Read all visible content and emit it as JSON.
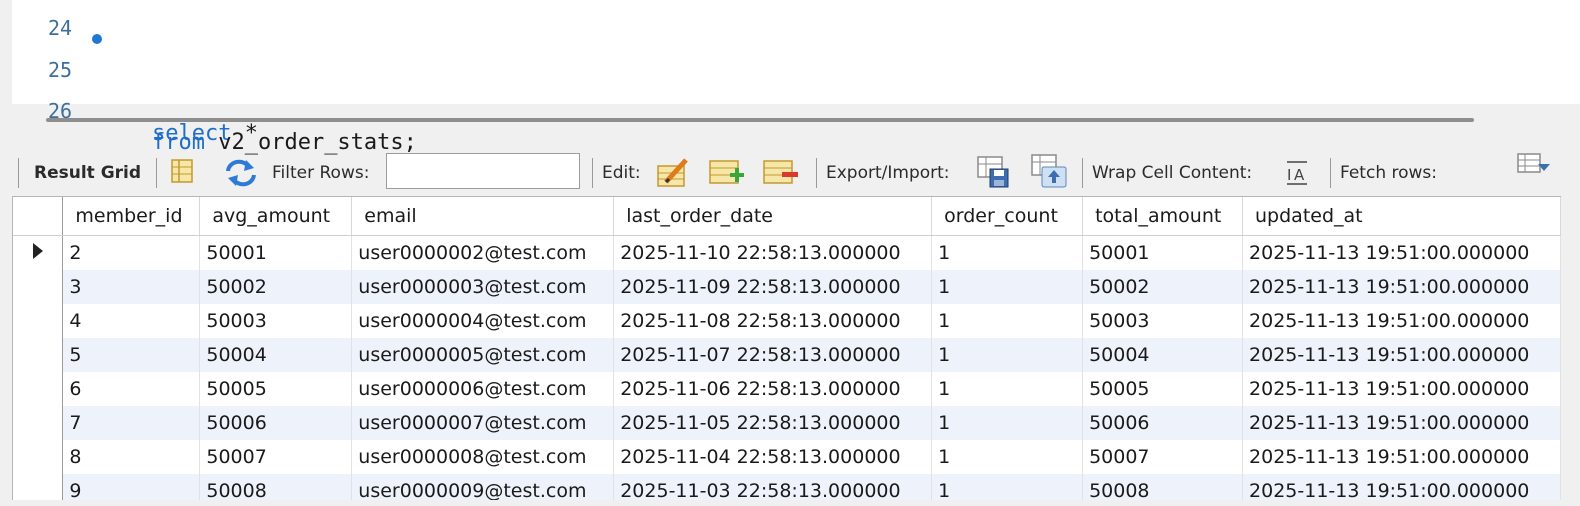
{
  "editor": {
    "partial_line_number": "24",
    "lines": [
      {
        "number": "25",
        "keyword": "select",
        "rest": " *"
      },
      {
        "number": "26",
        "keyword": "from",
        "rest": " v2_order_stats;"
      }
    ]
  },
  "toolbar": {
    "result_grid": "Result Grid",
    "filter_rows": "Filter Rows:",
    "filter_value": "",
    "edit": "Edit:",
    "export_import": "Export/Import:",
    "wrap": "Wrap Cell Content:",
    "fetch": "Fetch rows:"
  },
  "grid": {
    "columns": [
      "member_id",
      "avg_amount",
      "email",
      "last_order_date",
      "order_count",
      "total_amount",
      "updated_at"
    ],
    "rows": [
      [
        "2",
        "50001",
        "user0000002@test.com",
        "2025-11-10 22:58:13.000000",
        "1",
        "50001",
        "2025-11-13 19:51:00.000000"
      ],
      [
        "3",
        "50002",
        "user0000003@test.com",
        "2025-11-09 22:58:13.000000",
        "1",
        "50002",
        "2025-11-13 19:51:00.000000"
      ],
      [
        "4",
        "50003",
        "user0000004@test.com",
        "2025-11-08 22:58:13.000000",
        "1",
        "50003",
        "2025-11-13 19:51:00.000000"
      ],
      [
        "5",
        "50004",
        "user0000005@test.com",
        "2025-11-07 22:58:13.000000",
        "1",
        "50004",
        "2025-11-13 19:51:00.000000"
      ],
      [
        "6",
        "50005",
        "user0000006@test.com",
        "2025-11-06 22:58:13.000000",
        "1",
        "50005",
        "2025-11-13 19:51:00.000000"
      ],
      [
        "7",
        "50006",
        "user0000007@test.com",
        "2025-11-05 22:58:13.000000",
        "1",
        "50006",
        "2025-11-13 19:51:00.000000"
      ],
      [
        "8",
        "50007",
        "user0000008@test.com",
        "2025-11-04 22:58:13.000000",
        "1",
        "50007",
        "2025-11-13 19:51:00.000000"
      ],
      [
        "9",
        "50008",
        "user0000009@test.com",
        "2025-11-03 22:58:13.000000",
        "1",
        "50008",
        "2025-11-13 19:51:00.000000"
      ]
    ],
    "selected_row_index": 0
  },
  "colors": {
    "keyword": "#1f6fc9",
    "line_number": "#3d6f9a",
    "alt_row": "#eef3fb"
  },
  "icons": [
    "breakpoint-dot-icon",
    "form-editor-icon",
    "refresh-icon",
    "edit-row-icon",
    "insert-row-icon",
    "delete-row-icon",
    "export-icon",
    "import-icon",
    "wrap-cell-icon",
    "fetch-rows-icon",
    "row-pointer-icon"
  ]
}
